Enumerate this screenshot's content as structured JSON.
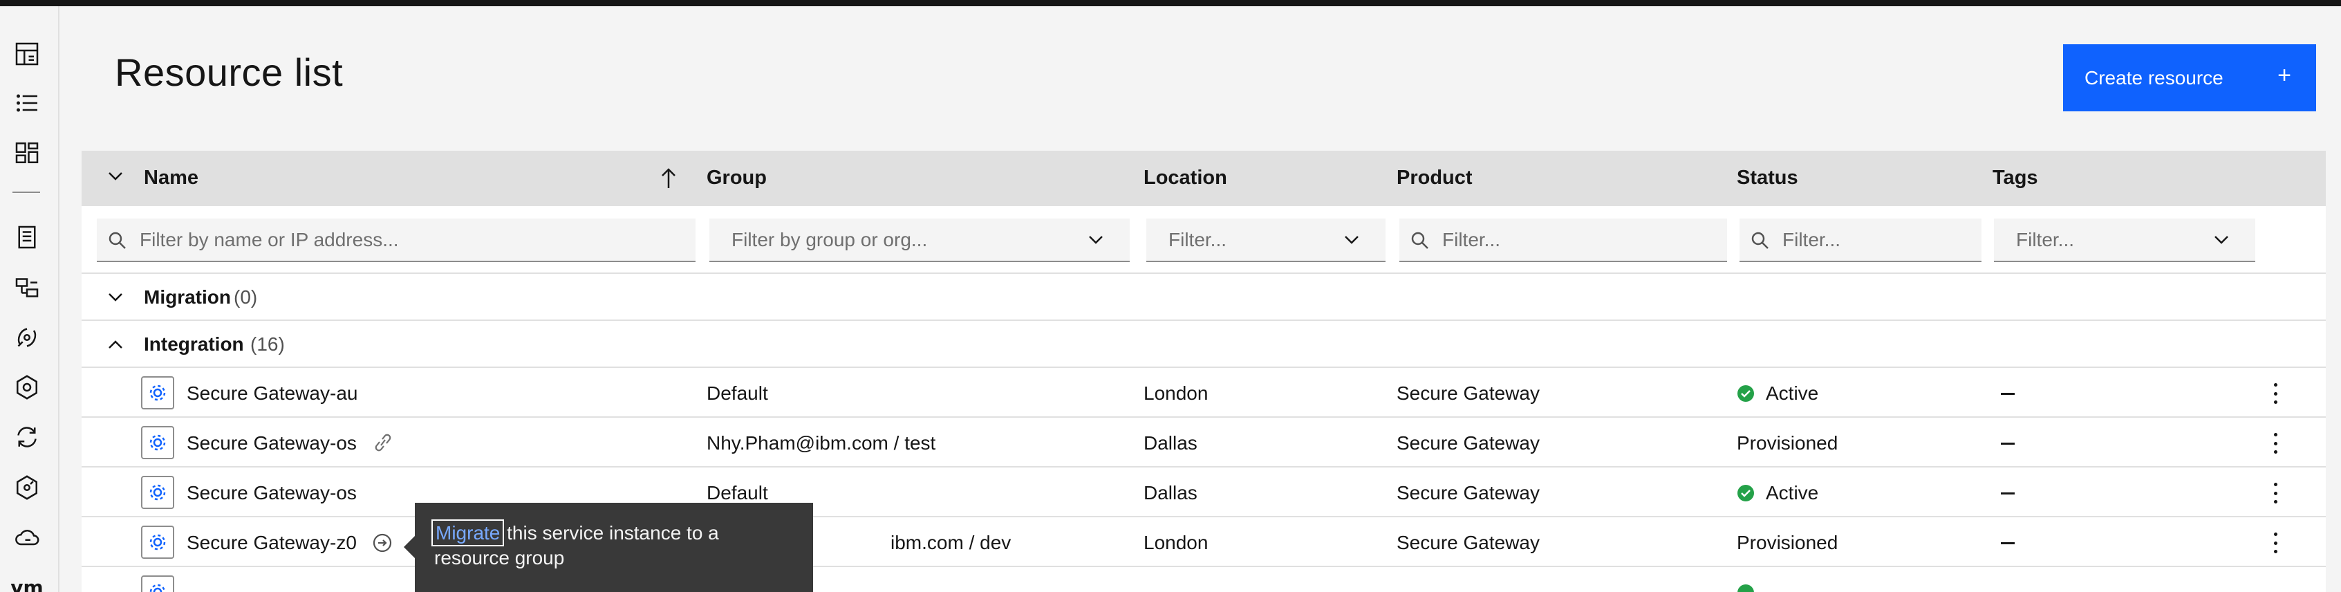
{
  "header": {
    "title": "Resource list",
    "create_label": "Create resource",
    "create_icon": "+"
  },
  "sidenav": {
    "items": [
      "dashboard-icon",
      "list-icon",
      "catalog-icon",
      "billing-icon",
      "classic-infrastructure-icon",
      "satellite-icon",
      "vpc-icon",
      "automation-icon",
      "security-icon",
      "cloud-icon"
    ],
    "vm_label": "vm"
  },
  "table": {
    "columns": [
      "Name",
      "Group",
      "Location",
      "Product",
      "Status",
      "Tags"
    ],
    "filters": {
      "name": "Filter by name or IP address...",
      "group": "Filter by group or org...",
      "location": "Filter...",
      "product": "Filter...",
      "status": "Filter...",
      "tags": "Filter..."
    },
    "groups": [
      {
        "label": "Migration",
        "count": "(0)"
      },
      {
        "label": "Integration",
        "count": "(16)"
      }
    ],
    "rows": [
      {
        "name": "Secure Gateway-au",
        "group": "Default",
        "location": "London",
        "product": "Secure Gateway",
        "status": "Active",
        "tags": "–"
      },
      {
        "name": "Secure Gateway-os",
        "group": "Nhy.Pham@ibm.com / test",
        "location": "Dallas",
        "product": "Secure Gateway",
        "status": "Provisioned",
        "tags": "–"
      },
      {
        "name": "Secure Gateway-os",
        "group": "Default",
        "location": "Dallas",
        "product": "Secure Gateway",
        "status": "Active",
        "tags": "–"
      },
      {
        "name": "Secure Gateway-z0",
        "group": "ibm.com / dev",
        "location": "London",
        "product": "Secure Gateway",
        "status": "Provisioned",
        "tags": "–"
      }
    ]
  },
  "tooltip": {
    "link": "Migrate",
    "text_line1": " this service instance to a",
    "text_line2": "resource group"
  },
  "colors": {
    "accent": "#0f62fe",
    "active": "#24a148",
    "tooltip_bg": "#393939"
  }
}
